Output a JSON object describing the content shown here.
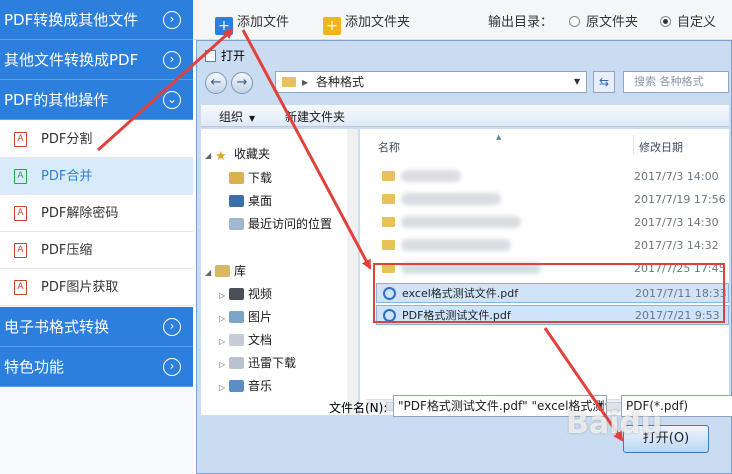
{
  "sidebar": {
    "headers": [
      {
        "label": "PDF转换成其他文件",
        "icon": "chevron-right-icon"
      },
      {
        "label": "其他文件转换成PDF",
        "icon": "chevron-right-icon"
      },
      {
        "label": "PDF的其他操作",
        "icon": "chevron-down-icon"
      },
      {
        "label": "电子书格式转换",
        "icon": "chevron-right-icon"
      },
      {
        "label": "特色功能",
        "icon": "chevron-right-icon"
      }
    ],
    "items": [
      {
        "label": "PDF分割",
        "active": false
      },
      {
        "label": "PDF合并",
        "active": true
      },
      {
        "label": "PDF解除密码",
        "active": false
      },
      {
        "label": "PDF压缩",
        "active": false
      },
      {
        "label": "PDF图片获取",
        "active": false
      }
    ]
  },
  "toolbar": {
    "add_file": "添加文件",
    "add_folder": "添加文件夹",
    "output_label": "输出目录：",
    "output_options": [
      {
        "label": "原文件夹",
        "selected": false
      },
      {
        "label": "自定义",
        "selected": true
      }
    ]
  },
  "dialog": {
    "title": "打开",
    "address": "各种格式",
    "search_placeholder": "搜索 各种格式",
    "commands": {
      "organize": "组织",
      "new_folder": "新建文件夹"
    },
    "nav": {
      "favorites": "收藏夹",
      "favorites_items": [
        "下载",
        "桌面",
        "最近访问的位置"
      ],
      "libraries": "库",
      "library_items": [
        "视频",
        "图片",
        "文档",
        "迅雷下载",
        "音乐"
      ]
    },
    "columns": {
      "name": "名称",
      "modified": "修改日期"
    },
    "folders": [
      {
        "date": "2017/7/3 14:00"
      },
      {
        "date": "2017/7/19 17:56"
      },
      {
        "date": "2017/7/3 14:30"
      },
      {
        "date": "2017/7/3 14:32"
      },
      {
        "date": "2017/7/25 17:45"
      }
    ],
    "files": [
      {
        "name": "excel格式测试文件.pdf",
        "date": "2017/7/11 18:33",
        "selected": true
      },
      {
        "name": "PDF格式测试文件.pdf",
        "date": "2017/7/21 9:53",
        "selected": true
      }
    ],
    "filename_label": "文件名(N):",
    "filename_value": "\"PDF格式测试文件.pdf\" \"excel格式测试文件.pdf\"",
    "file_type": "PDF(*.pdf)",
    "open_button": "打开(O)"
  },
  "watermark": "Baidu",
  "colors": {
    "sidebar_blue": "#2d7fde",
    "annotation_red": "#e1413a",
    "selection": "#cfe4fa"
  }
}
